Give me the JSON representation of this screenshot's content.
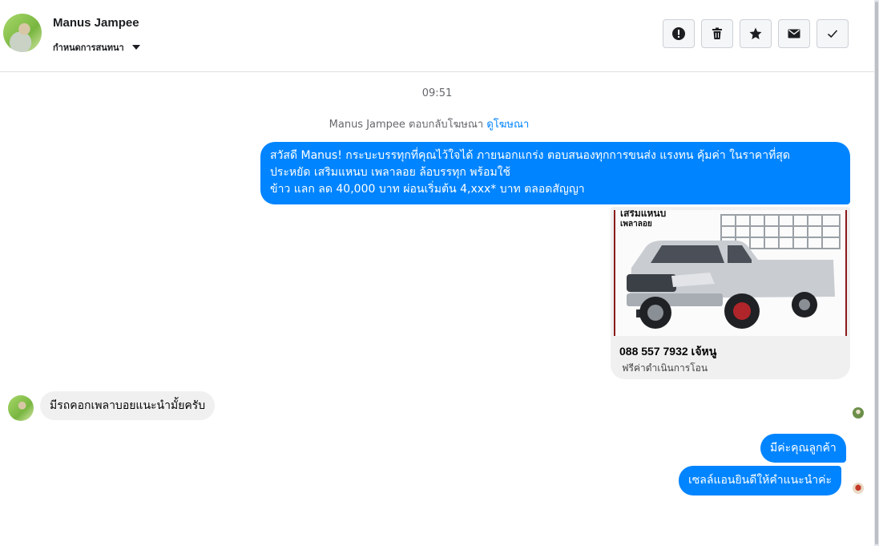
{
  "header": {
    "contact_name": "Manus Jampee",
    "label_menu": "กำหนดการสนทนา",
    "actions": [
      {
        "name": "mark-spam",
        "icon": "exclamation-circle-icon"
      },
      {
        "name": "delete",
        "icon": "trash-icon"
      },
      {
        "name": "star",
        "icon": "star-icon"
      },
      {
        "name": "mark-unread",
        "icon": "envelope-icon"
      },
      {
        "name": "mark-done",
        "icon": "check-icon"
      }
    ]
  },
  "conversation": {
    "timestamp": "09:51",
    "ad_reply_text": "Manus Jampee ตอบกลับโฆษณา",
    "ad_link": "ดูโฆษณา",
    "outgoing_message_lines": [
      "สวัสดี Manus! กระบะบรรทุกที่คุณไว้ใจได้ ภายนอกแกร่ง ตอบสนองทุกการขนส่ง แรงทน คุ้มค่า ในราคาที่สุด",
      "ประหยัด เสริมแหนบ เพลาลอย ล้อบรรทุก พร้อมใช้",
      "ข้าว แลก ลด 40,000 บาท ผ่อนเริ่มต้น 4,xxx* บาท ตลอดสัญญา"
    ],
    "ad_card": {
      "image_text_line1": "เสริมแหนบ",
      "image_text_line2": "เพลาลอย",
      "title": "088 557 7932 เจ้หนู",
      "subtitle": "ฟรีค่าดำเนินการโอน"
    },
    "incoming_message": "มีรถคอกเพลาบอยแนะนำมั้ยครับ",
    "reply_1": "มีค่ะคุณลูกค้า",
    "reply_2": "เซลล์แอนยินดีให้คำแนะนำค่ะ"
  },
  "colors": {
    "accent": "#0084ff",
    "incoming_bubble": "#f1f0f0",
    "divider": "#dddfe2"
  }
}
